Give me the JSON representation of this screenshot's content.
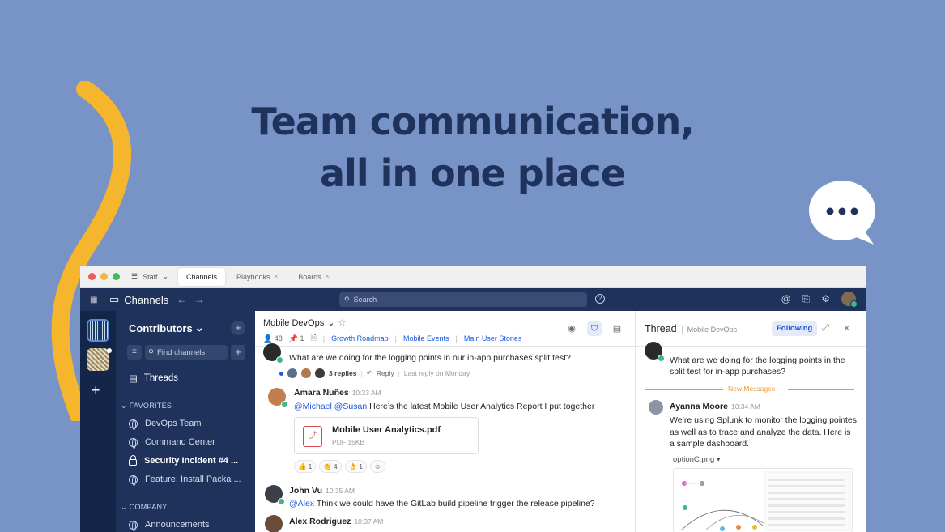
{
  "hero": {
    "line1": "Team communication,",
    "line2": "all in one place"
  },
  "colors": {
    "background": "#7893c6",
    "navy": "#1e325c",
    "accent": "#1c58d9",
    "swirl": "#f5b62e"
  },
  "tabbar": {
    "workspace": "Staff",
    "tabs": [
      {
        "label": "Channels"
      },
      {
        "label": "Playbooks"
      },
      {
        "label": "Boards"
      }
    ]
  },
  "topbar": {
    "title": "Channels",
    "search_placeholder": "Search"
  },
  "sidebar": {
    "team_name": "Contributors",
    "find_placeholder": "Find channels",
    "threads_label": "Threads",
    "favorites_label": "FAVORITES",
    "favorites": [
      {
        "label": "DevOps Team"
      },
      {
        "label": "Command Center"
      },
      {
        "label": "Security Incident #4 ..."
      },
      {
        "label": "Feature: Install Packa ..."
      }
    ],
    "company_label": "COMPANY",
    "company": [
      {
        "label": "Announcements"
      }
    ]
  },
  "channel": {
    "name": "Mobile DevOps",
    "members": "48",
    "pinned": "1",
    "bookmarks": [
      "Growth Roadmap",
      "Mobile Events",
      "Main User Stories"
    ]
  },
  "messages": [
    {
      "text": "What are we doing for the logging points in our in-app purchases split test?",
      "replies": "3 replies",
      "reply_label": "Reply",
      "last_reply": "Last reply on Monday"
    },
    {
      "author": "Amara Nuñes",
      "time": "10:33 AM",
      "mentions": "@Michael @Susan",
      "text": " Here’s the latest Mobile User Analytics Report I put together",
      "file": {
        "name": "Mobile User Analytics.pdf",
        "meta": "PDF 15KB"
      },
      "reactions": [
        {
          "emoji": "👍",
          "count": "1"
        },
        {
          "emoji": "👏",
          "count": "4"
        },
        {
          "emoji": "👌",
          "count": "1"
        }
      ]
    },
    {
      "author": "John Vu",
      "time": "10:35 AM",
      "mentions": "@Alex",
      "text": " Think we could have the GitLab build pipeline trigger the release pipeline?"
    },
    {
      "author": "Alex Rodriguez",
      "time": "10:37 AM"
    }
  ],
  "thread": {
    "title": "Thread",
    "channel": "Mobile DevOps",
    "following_label": "Following",
    "root_text": "What are we doing for the logging points in the split test for in-app purchases?",
    "new_messages_label": "New Messages",
    "reply": {
      "author": "Ayanna Moore",
      "time": "10:34 AM",
      "text": "We’re using Splunk to monitor the logging pointes as well as to trace and analyze the data. Here is a sample dashboard."
    },
    "attachment_name": "optionC.png"
  }
}
